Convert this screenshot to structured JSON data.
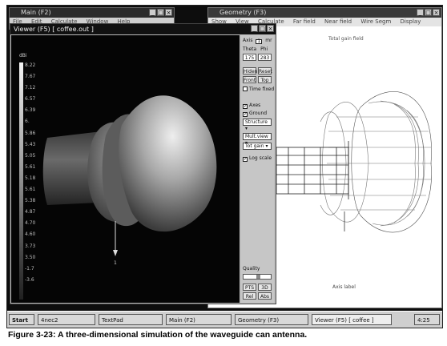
{
  "main_window": {
    "title": "Main (F2)",
    "menu": [
      "File",
      "Edit",
      "Calculate",
      "Window",
      "Help"
    ]
  },
  "geometry_window": {
    "title": "Geometry (F3)",
    "menu": [
      "Show",
      "View",
      "Calculate",
      "Far field",
      "Near field",
      "Wire Segm",
      "Display"
    ],
    "canvas_title": "Total gain field",
    "axis_label": "Axis label"
  },
  "viewer_window": {
    "title": "Viewer (F5)    [ coffee.out ]",
    "colorbar_title": "dBi",
    "colorbar_ticks": [
      "8.22",
      "7.67",
      "7.12",
      "6.57",
      "6.39",
      "6.",
      "5.86",
      "5.43",
      "5.05",
      "5.61",
      "5.18",
      "5.61",
      "5.38",
      "4.87",
      "4.70",
      "4.60",
      "3.73",
      "3.50",
      "-1.7",
      "-3.6"
    ],
    "feed_label": "1"
  },
  "panel": {
    "axis_label": "Axis",
    "axis_value": "1",
    "mr_label": "mr",
    "theta_label": "Theta",
    "phi_label": "Phi",
    "theta_value": "175",
    "phi_value": "283",
    "btn_hidden": "Hiden",
    "btn_reset": "Reset",
    "btn_front": "Front",
    "btn_top": "Top",
    "time_fixed": "Time fixed",
    "axes": "Axes",
    "ground": "Ground",
    "select_structure": "Structure",
    "select_mode": "Mult.view",
    "select_field": "Tot gain",
    "log_scale": "Log scale",
    "quality_label": "Quality",
    "btn_pts": "PTS",
    "btn_3d": "3D",
    "btn_rel": "Rel",
    "btn_abs": "Abs"
  },
  "taskbar": {
    "items": [
      "Start",
      "4nec2",
      "TextPad",
      "Main (F2)",
      "Geometry (F3)",
      "Viewer (F5) [ coffee ]"
    ],
    "clock": "4:25"
  },
  "caption": "Figure 3-23: A three-dimensional simulation of the waveguide can antenna."
}
